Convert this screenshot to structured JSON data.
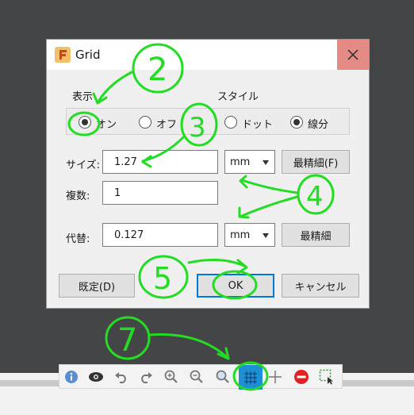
{
  "dialog": {
    "title": "Grid",
    "display_label": "表示",
    "style_label": "スタイル",
    "radio_on": "オン",
    "radio_off": "オフ",
    "radio_dot": "ドット",
    "radio_line": "線分",
    "size_label": "サイズ:",
    "size_value": "1.27",
    "size_unit": "mm",
    "finest_f_label": "最精細(F)",
    "multiple_label": "複数:",
    "multiple_value": "1",
    "alternate_label": "代替:",
    "alternate_value": "0.127",
    "alternate_unit": "mm",
    "finest_label": "最精細",
    "default_button": "既定(D)",
    "ok_button": "OK",
    "cancel_button": "キャンセル"
  },
  "annotations": {
    "n2": "2",
    "n3": "3",
    "n4": "4",
    "n5": "5",
    "n7": "7",
    "color": "#22dd22"
  },
  "toolbar": {
    "icons": [
      "info-icon",
      "eye-icon",
      "undo-icon",
      "redo-icon",
      "zoom-in-icon",
      "zoom-out-icon",
      "zoom-fit-icon",
      "grid-icon",
      "crosshair-icon",
      "stop-icon",
      "select-icon"
    ],
    "active": "grid-icon",
    "accent": "#1f8fd6"
  }
}
